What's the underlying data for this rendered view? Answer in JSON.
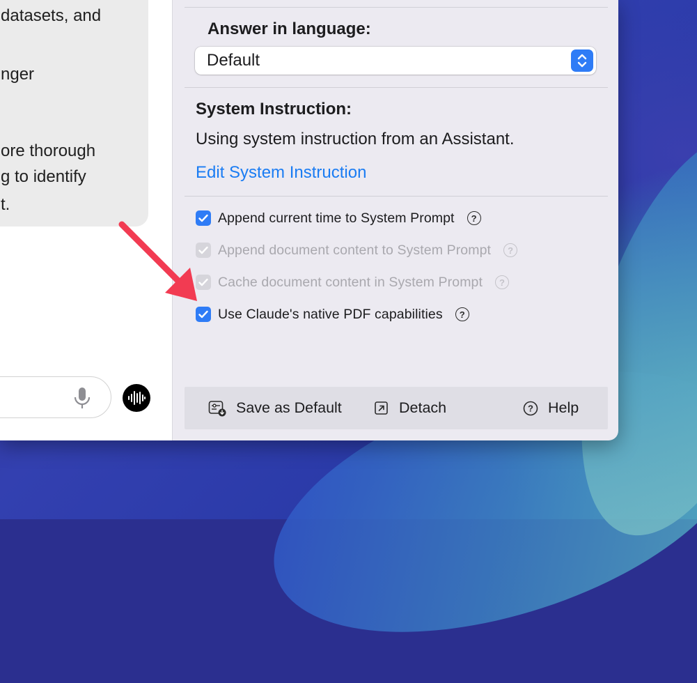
{
  "chat": {
    "bubble_lines": [
      "datasets, and",
      "nger",
      "ore thorough",
      "g to identify",
      "t."
    ]
  },
  "settings": {
    "language_label": "Answer in language:",
    "language_value": "Default",
    "system_instruction_label": "System Instruction:",
    "system_instruction_text": "Using system instruction from an Assistant.",
    "edit_link": "Edit System Instruction",
    "options": [
      {
        "label": "Append current time to System Prompt",
        "checked": true,
        "enabled": true
      },
      {
        "label": "Append document content to System Prompt",
        "checked": true,
        "enabled": false
      },
      {
        "label": "Cache document content in System Prompt",
        "checked": true,
        "enabled": false
      },
      {
        "label": "Use Claude's native PDF capabilities",
        "checked": true,
        "enabled": true
      }
    ],
    "help_glyph": "?"
  },
  "footer": {
    "save_default": "Save as Default",
    "detach": "Detach",
    "help": "Help"
  },
  "colors": {
    "accent": "#2f7cf6",
    "link": "#1a7cf3",
    "annotation_arrow": "#f23b52"
  }
}
